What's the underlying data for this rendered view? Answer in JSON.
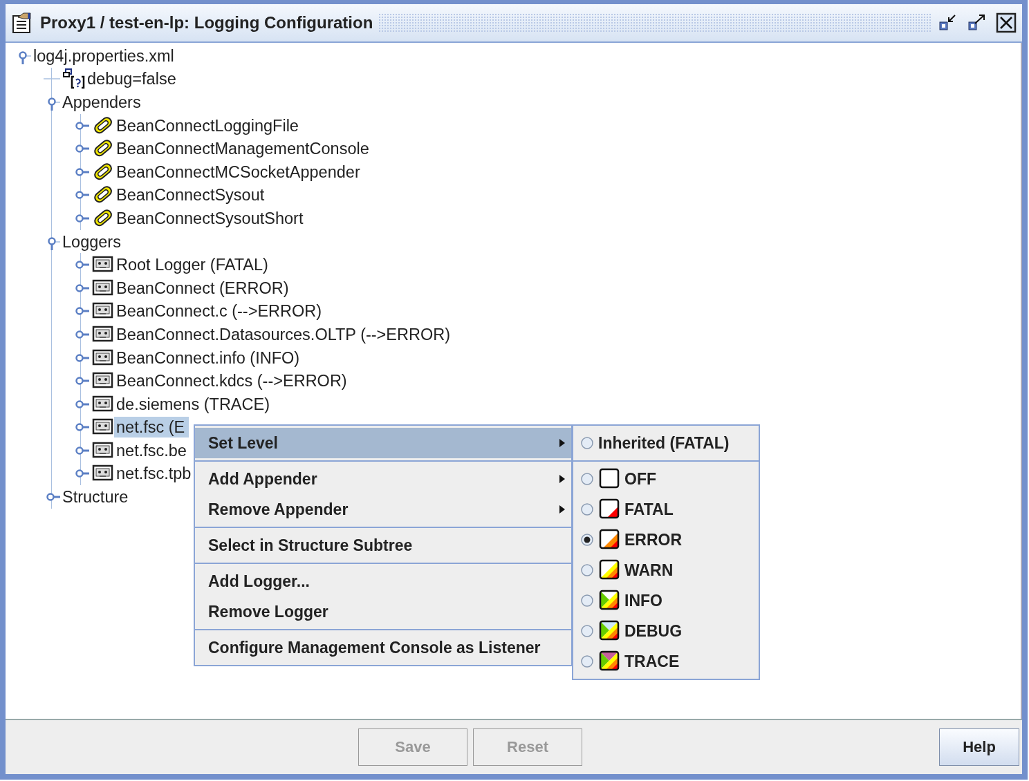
{
  "window": {
    "title": "Proxy1 / test-en-lp: Logging Configuration"
  },
  "tree": [
    {
      "label": "log4j.properties.xml",
      "expanded": true,
      "selected": false,
      "children": [
        {
          "label": "debug=false",
          "kind": "property",
          "selected": false
        },
        {
          "label": "Appenders",
          "expanded": true,
          "selected": false,
          "children": [
            {
              "label": "BeanConnectLoggingFile",
              "kind": "appender",
              "expanded": false,
              "selected": false
            },
            {
              "label": "BeanConnectManagementConsole",
              "kind": "appender",
              "expanded": false,
              "selected": false
            },
            {
              "label": "BeanConnectMCSocketAppender",
              "kind": "appender",
              "expanded": false,
              "selected": false
            },
            {
              "label": "BeanConnectSysout",
              "kind": "appender",
              "expanded": false,
              "selected": false
            },
            {
              "label": "BeanConnectSysoutShort",
              "kind": "appender",
              "expanded": false,
              "selected": false
            }
          ]
        },
        {
          "label": "Loggers",
          "expanded": true,
          "selected": false,
          "children": [
            {
              "label": "Root Logger (FATAL)",
              "kind": "logger",
              "expanded": false,
              "selected": false
            },
            {
              "label": "BeanConnect (ERROR)",
              "kind": "logger",
              "expanded": false,
              "selected": false
            },
            {
              "label": "BeanConnect.c (-->ERROR)",
              "kind": "logger",
              "expanded": false,
              "selected": false
            },
            {
              "label": "BeanConnect.Datasources.OLTP (-->ERROR)",
              "kind": "logger",
              "expanded": false,
              "selected": false
            },
            {
              "label": "BeanConnect.info (INFO)",
              "kind": "logger",
              "expanded": false,
              "selected": false
            },
            {
              "label": "BeanConnect.kdcs (-->ERROR)",
              "kind": "logger",
              "expanded": false,
              "selected": false
            },
            {
              "label": "de.siemens (TRACE)",
              "kind": "logger",
              "expanded": false,
              "selected": false
            },
            {
              "label": "net.fsc (E",
              "kind": "logger",
              "expanded": false,
              "selected": true
            },
            {
              "label": "net.fsc.be",
              "kind": "logger",
              "expanded": false,
              "selected": false
            },
            {
              "label": "net.fsc.tpb",
              "kind": "logger",
              "expanded": false,
              "selected": false
            }
          ]
        },
        {
          "label": "Structure",
          "expanded": false,
          "selected": false
        }
      ]
    }
  ],
  "context_menu": {
    "groups": [
      [
        {
          "label": "Set Level",
          "submenu": true,
          "selected": true
        }
      ],
      [
        {
          "label": "Add Appender",
          "submenu": true,
          "selected": false
        },
        {
          "label": "Remove Appender",
          "submenu": true,
          "selected": false
        }
      ],
      [
        {
          "label": "Select in Structure Subtree",
          "submenu": false,
          "selected": false
        }
      ],
      [
        {
          "label": "Add Logger...",
          "submenu": false,
          "selected": false
        },
        {
          "label": "Remove Logger",
          "submenu": false,
          "selected": false
        }
      ],
      [
        {
          "label": "Configure Management Console as Listener",
          "submenu": false,
          "selected": false
        }
      ]
    ]
  },
  "level_menu": {
    "groups": [
      [
        {
          "label": "Inherited (FATAL)",
          "kind": "inherited",
          "selected": false
        }
      ],
      [
        {
          "label": "OFF",
          "kind": "off",
          "selected": false
        },
        {
          "label": "FATAL",
          "kind": "fatal",
          "selected": false
        },
        {
          "label": "ERROR",
          "kind": "error",
          "selected": true
        },
        {
          "label": "WARN",
          "kind": "warn",
          "selected": false
        },
        {
          "label": "INFO",
          "kind": "info",
          "selected": false
        },
        {
          "label": "DEBUG",
          "kind": "debug",
          "selected": false
        },
        {
          "label": "TRACE",
          "kind": "trace",
          "selected": false
        }
      ]
    ]
  },
  "buttons": [
    {
      "label": "Save",
      "disabled": true
    },
    {
      "label": "Reset",
      "disabled": true
    },
    {
      "label": "Help",
      "disabled": false
    }
  ]
}
